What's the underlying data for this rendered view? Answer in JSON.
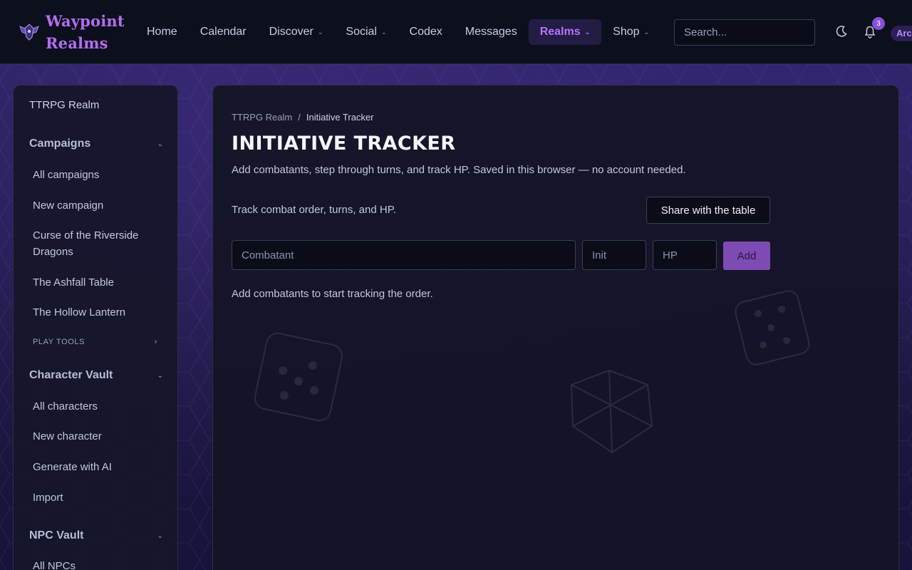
{
  "brand": {
    "line1": "Waypoint",
    "line2": "Realms"
  },
  "nav": {
    "items": [
      {
        "label": "Home",
        "has_menu": false
      },
      {
        "label": "Calendar",
        "has_menu": false
      },
      {
        "label": "Discover",
        "has_menu": true
      },
      {
        "label": "Social",
        "has_menu": true
      },
      {
        "label": "Codex",
        "has_menu": false
      },
      {
        "label": "Messages",
        "has_menu": false
      },
      {
        "label": "Realms",
        "has_menu": true,
        "active": true
      },
      {
        "label": "Shop",
        "has_menu": true
      }
    ],
    "chevron": "⌄"
  },
  "search": {
    "placeholder": "Search..."
  },
  "notifications": {
    "count": "3"
  },
  "user": {
    "chip": "Arc"
  },
  "sidebar": {
    "realm": "TTRPG Realm",
    "campaigns": {
      "heading": "Campaigns",
      "links": [
        "All campaigns",
        "New campaign",
        "Curse of the Riverside Dragons",
        "The Ashfall Table",
        "The Hollow Lantern"
      ]
    },
    "play_tools": "PLAY TOOLS",
    "characters": {
      "heading": "Character Vault",
      "links": [
        "All characters",
        "New character",
        "Generate with AI",
        "Import"
      ]
    },
    "npcs": {
      "heading": "NPC Vault",
      "links": [
        "All NPCs"
      ]
    }
  },
  "main": {
    "breadcrumb": {
      "parent": "TTRPG Realm",
      "separator": "/",
      "current": "Initiative Tracker"
    },
    "title": "INITIATIVE TRACKER",
    "subtitle": "Add combatants, step through turns, and track HP. Saved in this browser — no account needed.",
    "track_text": "Track combat order, turns, and HP.",
    "share_label": "Share with the table",
    "form": {
      "combatant_placeholder": "Combatant",
      "init_placeholder": "Init",
      "hp_placeholder": "HP",
      "add_label": "Add"
    },
    "empty_text": "Add combatants to start tracking the order."
  },
  "colors": {
    "accent": "#b56cf0",
    "add_button": "#7d4bb3",
    "topbar": "#0c0f1c",
    "panel": "#141426"
  }
}
